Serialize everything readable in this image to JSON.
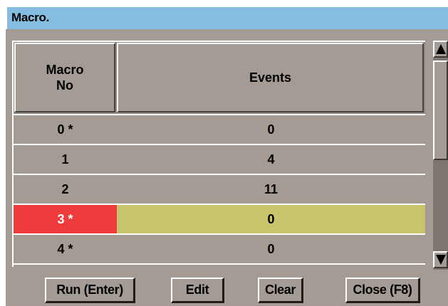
{
  "window": {
    "title": "Macro."
  },
  "table": {
    "headers": {
      "macro_no": "Macro\nNo",
      "events": "Events"
    },
    "rows": [
      {
        "macro_no": "0 *",
        "events": "0",
        "selected": false
      },
      {
        "macro_no": "1",
        "events": "4",
        "selected": false
      },
      {
        "macro_no": "2",
        "events": "11",
        "selected": false
      },
      {
        "macro_no": "3 *",
        "events": "0",
        "selected": true
      },
      {
        "macro_no": "4 *",
        "events": "0",
        "selected": false
      },
      {
        "macro_no": "",
        "events": "",
        "selected": false
      }
    ]
  },
  "buttons": {
    "run": "Run (Enter)",
    "edit": "Edit",
    "clear": "Clear",
    "close": "Close (F8)"
  },
  "colors": {
    "title_bar": "#85bde0",
    "panel": "#a39b94",
    "selected_macro_no": "#ee3b3b",
    "selected_events": "#c7c46b"
  },
  "icons": {
    "scroll_up": "triangle-up-icon",
    "scroll_down": "triangle-down-icon"
  }
}
